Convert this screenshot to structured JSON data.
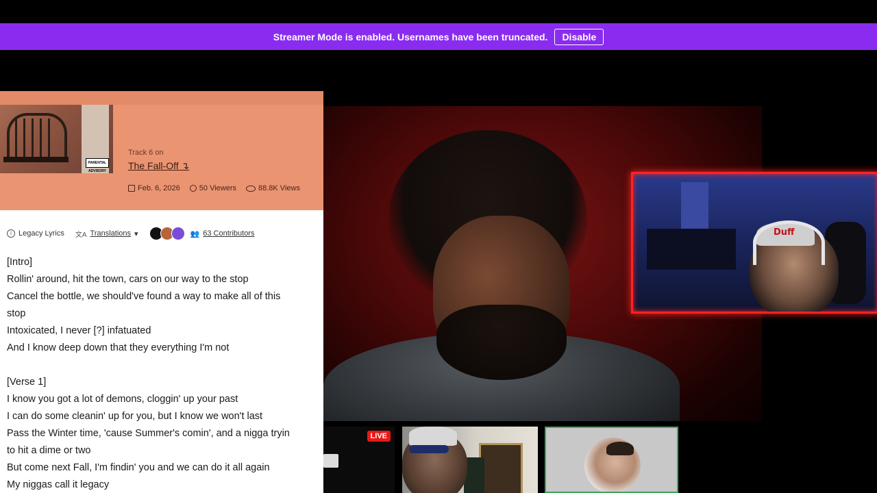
{
  "banner": {
    "message": "Streamer Mode is enabled. Usernames have been truncated.",
    "disable_label": "Disable",
    "color": "#8a2cf0"
  },
  "lyrics_panel": {
    "track_label": "Track 6 on",
    "album_title": "The Fall-Off ↴",
    "release_date": "Feb. 6, 2026",
    "viewers": "50 Viewers",
    "views": "88.8K Views",
    "legacy_label": "Legacy Lyrics",
    "translations_label": "Translations",
    "contributors_label": "63 Contributors",
    "explicit_badge": "PARENTAL ADVISORY",
    "header_color": "#ea9472",
    "lines": [
      "[Intro]",
      "Rollin' around, hit the town, cars on our way to the stop",
      "Cancel the bottle, we should've found a way to make all of this",
      "stop",
      "Intoxicated, I never [?] infatuated",
      "And I know deep down that they everything I'm not",
      "",
      "[Verse 1]",
      "I know you got a lot of demons, cloggin' up your past",
      "I can do some cleanin' up for you, but I know we won't last",
      "Pass the Winter time, 'cause Summer's comin', and a nigga tryin",
      "to hit a dime or two",
      "But come next Fall, I'm findin' you and we can do it all again",
      "My niggas call it legacy"
    ]
  },
  "webcam": {
    "cap_logo": "Duff",
    "border_color": "#ff2323"
  },
  "tiles": {
    "live_label": "LIVE",
    "live_color": "#e91916",
    "active_border_color": "#3fa65a"
  }
}
